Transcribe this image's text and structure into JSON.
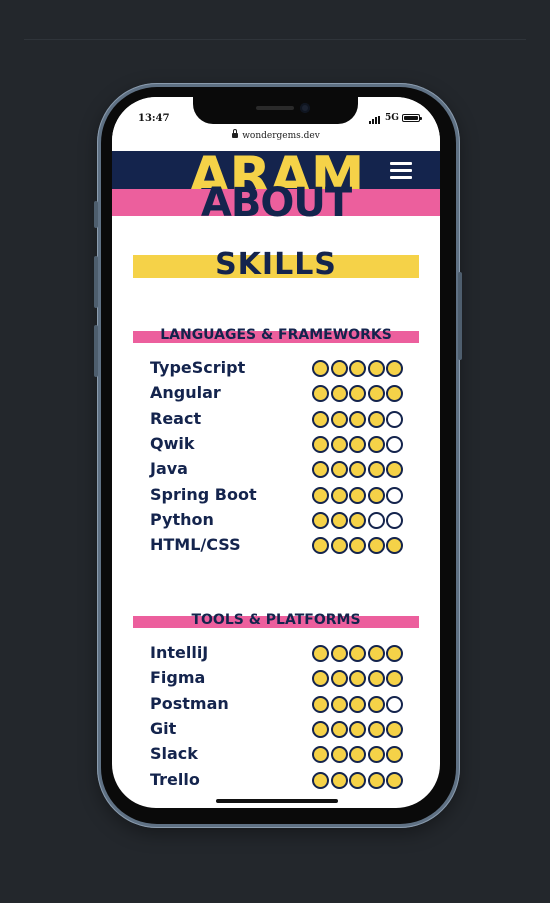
{
  "status": {
    "time": "13:47",
    "network": "5G"
  },
  "browser": {
    "url": "wondergems.dev"
  },
  "header": {
    "brand": "ARAM",
    "section": "ABOUT"
  },
  "page": {
    "title": "SKILLS"
  },
  "sections": [
    {
      "title": "LANGUAGES & FRAMEWORKS",
      "skills": [
        {
          "name": "TypeScript",
          "level": 5,
          "max": 5
        },
        {
          "name": "Angular",
          "level": 5,
          "max": 5
        },
        {
          "name": "React",
          "level": 4,
          "max": 5
        },
        {
          "name": "Qwik",
          "level": 4,
          "max": 5
        },
        {
          "name": "Java",
          "level": 5,
          "max": 5
        },
        {
          "name": "Spring Boot",
          "level": 4,
          "max": 5
        },
        {
          "name": "Python",
          "level": 3,
          "max": 5
        },
        {
          "name": "HTML/CSS",
          "level": 5,
          "max": 5
        }
      ]
    },
    {
      "title": "TOOLS & PLATFORMS",
      "skills": [
        {
          "name": "IntelliJ",
          "level": 5,
          "max": 5
        },
        {
          "name": "Figma",
          "level": 5,
          "max": 5
        },
        {
          "name": "Postman",
          "level": 4,
          "max": 5
        },
        {
          "name": "Git",
          "level": 5,
          "max": 5
        },
        {
          "name": "Slack",
          "level": 5,
          "max": 5
        },
        {
          "name": "Trello",
          "level": 5,
          "max": 5
        }
      ]
    }
  ],
  "icons": {
    "menu": "hamburger-menu-icon",
    "lock": "lock-icon",
    "rating": "rating-dot-icon"
  },
  "colors": {
    "navy": "#14244d",
    "yellow": "#f5d248",
    "pink": "#ec5f9d",
    "background": "#23272c"
  }
}
